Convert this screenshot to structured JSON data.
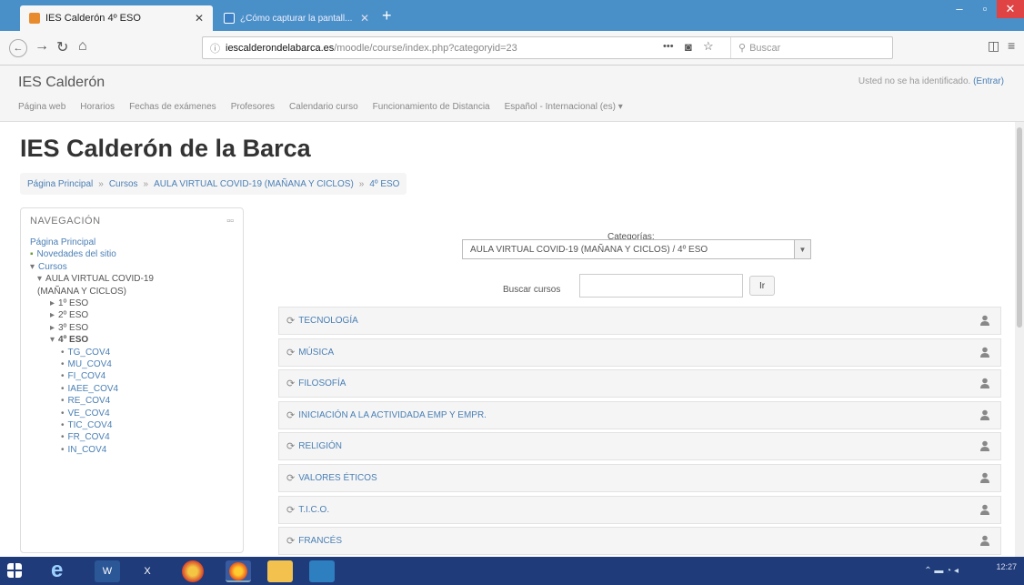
{
  "browser": {
    "tabs": [
      {
        "label": "IES Calderón 4º ESO",
        "active": true
      },
      {
        "label": "¿Cómo capturar la pantall...",
        "active": false
      }
    ],
    "url_domain": "iescalderondelabarca.es",
    "url_path": "/moodle/course/index.php?categoryid=23",
    "search_placeholder": "Buscar",
    "url_dots": "•••"
  },
  "site": {
    "name": "IES Calderón",
    "login_text": "Usted no se ha identificado.",
    "login_link": "(Entrar)",
    "menu": [
      "Página web",
      "Horarios",
      "Fechas de exámenes",
      "Profesores",
      "Calendario curso",
      "Funcionamiento de Distancia",
      "Español - Internacional (es) ▾"
    ]
  },
  "page": {
    "title": "IES Calderón de la Barca",
    "breadcrumb": [
      "Página Principal",
      "Cursos",
      "AULA VIRTUAL COVID-19 (MAÑANA Y CICLOS)",
      "4º ESO"
    ]
  },
  "navigation": {
    "title": "NAVEGACIÓN",
    "dock_icon": "▫▫",
    "items": [
      {
        "label": "Página Principal",
        "level": 0,
        "marker": ""
      },
      {
        "label": "Novedades del sitio",
        "level": 0,
        "marker": "▪"
      },
      {
        "label": "Cursos",
        "level": 0,
        "marker": "▾"
      },
      {
        "label": "AULA VIRTUAL COVID-19",
        "level": 1,
        "marker": "▾"
      },
      {
        "label": "(MAÑANA Y CICLOS)",
        "level": 1,
        "marker": ""
      },
      {
        "label": "1º ESO",
        "level": 2,
        "marker": "▸"
      },
      {
        "label": "2º ESO",
        "level": 2,
        "marker": "▸"
      },
      {
        "label": "3º ESO",
        "level": 2,
        "marker": "▸"
      },
      {
        "label": "4º ESO",
        "level": 2,
        "marker": "▾"
      },
      {
        "label": "TG_COV4",
        "level": 3,
        "marker": "•"
      },
      {
        "label": "MU_COV4",
        "level": 3,
        "marker": "•"
      },
      {
        "label": "FI_COV4",
        "level": 3,
        "marker": "•"
      },
      {
        "label": "IAEE_COV4",
        "level": 3,
        "marker": "•"
      },
      {
        "label": "RE_COV4",
        "level": 3,
        "marker": "•"
      },
      {
        "label": "VE_COV4",
        "level": 3,
        "marker": "•"
      },
      {
        "label": "TIC_COV4",
        "level": 3,
        "marker": "•"
      },
      {
        "label": "FR_COV4",
        "level": 3,
        "marker": "•"
      },
      {
        "label": "IN_COV4",
        "level": 3,
        "marker": "•"
      }
    ]
  },
  "categories": {
    "label": "Categorías:",
    "selected": "AULA VIRTUAL COVID-19 (MAÑANA Y CICLOS) / 4º ESO",
    "search_label": "Buscar cursos",
    "search_button": "Ir"
  },
  "courses": [
    "TECNOLOGÍA",
    "MÚSICA",
    "FILOSOFÍA",
    "INICIACIÓN A LA ACTIVIDADA EMP Y EMPR.",
    "RELIGIÓN",
    "VALORES ÉTICOS",
    "T.I.C.O.",
    "FRANCÉS"
  ],
  "taskbar": {
    "time": "12:27"
  },
  "colors": {
    "link": "#4a7fb5",
    "taskbar": "#1f3b7a",
    "tabbar": "#4a90c8"
  }
}
